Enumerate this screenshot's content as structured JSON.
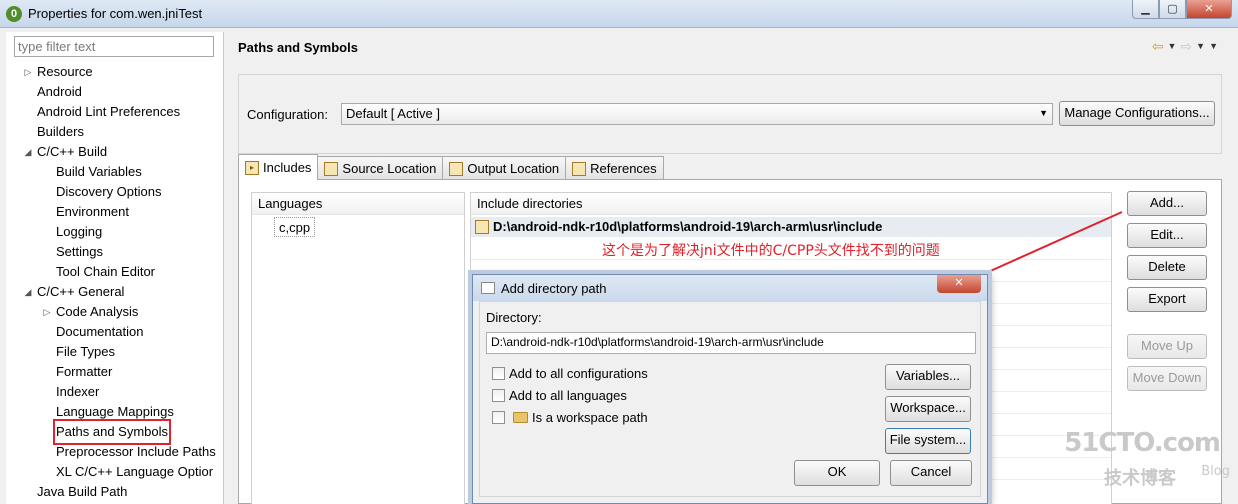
{
  "window": {
    "title": "Properties for com.wen.jniTest",
    "app_icon": "eclipse-icon",
    "controls": [
      "minimize",
      "maximize",
      "close"
    ]
  },
  "filter": {
    "placeholder": "type filter text"
  },
  "tree": [
    {
      "label": "Resource",
      "level": 0,
      "arrow": "right"
    },
    {
      "label": "Android",
      "level": 0
    },
    {
      "label": "Android Lint Preferences",
      "level": 0
    },
    {
      "label": "Builders",
      "level": 0
    },
    {
      "label": "C/C++ Build",
      "level": 0,
      "arrow": "down"
    },
    {
      "label": "Build Variables",
      "level": 1
    },
    {
      "label": "Discovery Options",
      "level": 1
    },
    {
      "label": "Environment",
      "level": 1
    },
    {
      "label": "Logging",
      "level": 1
    },
    {
      "label": "Settings",
      "level": 1
    },
    {
      "label": "Tool Chain Editor",
      "level": 1
    },
    {
      "label": "C/C++ General",
      "level": 0,
      "arrow": "down"
    },
    {
      "label": "Code Analysis",
      "level": 1,
      "arrow": "right"
    },
    {
      "label": "Documentation",
      "level": 1
    },
    {
      "label": "File Types",
      "level": 1
    },
    {
      "label": "Formatter",
      "level": 1
    },
    {
      "label": "Indexer",
      "level": 1
    },
    {
      "label": "Language Mappings",
      "level": 1
    },
    {
      "label": "Paths and Symbols",
      "level": 1,
      "selected": true
    },
    {
      "label": "Preprocessor Include Paths",
      "level": 1
    },
    {
      "label": "XL C/C++ Language Optior",
      "level": 1
    },
    {
      "label": "Java Build Path",
      "level": 0
    }
  ],
  "header": {
    "title": "Paths and Symbols"
  },
  "configuration": {
    "label": "Configuration:",
    "value": "Default  [ Active ]",
    "manage_button": "Manage Configurations..."
  },
  "tabs": [
    {
      "label": "Includes",
      "active": true
    },
    {
      "label": "Source Location"
    },
    {
      "label": "Output Location"
    },
    {
      "label": "References"
    }
  ],
  "languages": {
    "header": "Languages",
    "items": [
      "c,cpp"
    ]
  },
  "include_dirs": {
    "header": "Include directories",
    "rows": [
      "D:\\android-ndk-r10d\\platforms\\android-19\\arch-arm\\usr\\include"
    ]
  },
  "side_buttons": {
    "add": "Add...",
    "edit": "Edit...",
    "delete": "Delete",
    "export": "Export",
    "move_up": "Move Up",
    "move_down": "Move Down"
  },
  "annotation": "这个是为了解决jni文件中的C/CPP头文件找不到的问题",
  "dialog": {
    "title": "Add directory path",
    "directory_label": "Directory:",
    "directory_value": "D:\\android-ndk-r10d\\platforms\\android-19\\arch-arm\\usr\\include",
    "checkboxes": {
      "all_configs": "Add to all configurations",
      "all_languages": "Add to all languages",
      "workspace_path": "Is a workspace path"
    },
    "buttons": {
      "variables": "Variables...",
      "workspace": "Workspace...",
      "file_system": "File system...",
      "ok": "OK",
      "cancel": "Cancel"
    }
  },
  "watermark": {
    "line1": "51CTO.com",
    "line2": "技术博客",
    "line3": "Blog"
  },
  "colors": {
    "highlight_red": "#e0232b",
    "annotation_red": "#e0202a"
  }
}
